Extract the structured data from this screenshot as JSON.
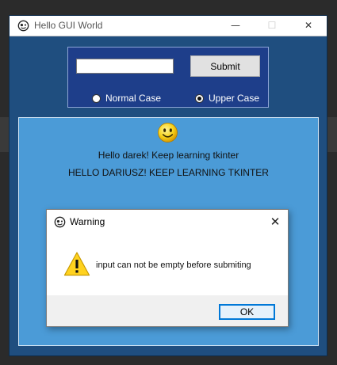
{
  "window": {
    "title": "Hello GUI World",
    "controls": {
      "minimize": "—",
      "maximize": "☐",
      "close": "✕"
    }
  },
  "entry_frame": {
    "input_value": "",
    "submit_label": "Submit",
    "radios": [
      {
        "label": "Normal Case",
        "selected": false
      },
      {
        "label": "Upper Case",
        "selected": true
      }
    ]
  },
  "message_frame": {
    "icon": "smiley-icon",
    "line1": "Hello darek! Keep learning tkinter",
    "line2": "HELLO DARIUSZ! KEEP LEARNING TKINTER"
  },
  "dialog": {
    "title": "Warning",
    "close_glyph": "✕",
    "icon": "warning-icon",
    "message": "input can not be empty before submiting",
    "ok_label": "OK"
  },
  "colors": {
    "window_bg": "#1f4e7f",
    "entry_frame_bg": "#1e3e8a",
    "message_frame_bg": "#4b9bd7",
    "accent": "#0078d7"
  }
}
